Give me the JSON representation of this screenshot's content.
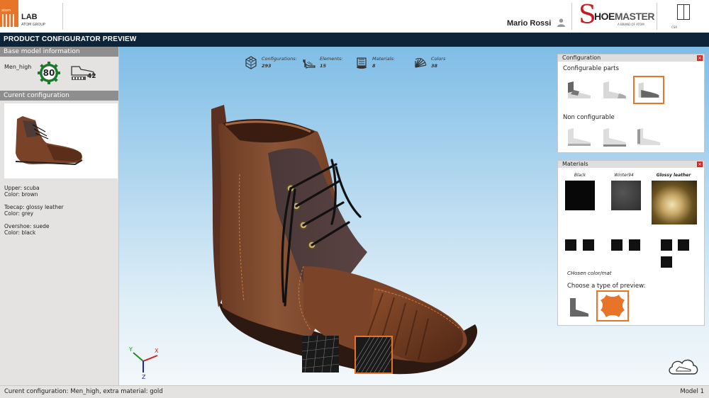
{
  "header": {
    "logo_small": "atom",
    "lab_title": "LAB",
    "lab_subtitle": "ATOM GROUP",
    "user_name": "Mario Rossi",
    "brand_name_1": "HOE",
    "brand_name_2": "MASTER",
    "brand_initial": "S",
    "brand_tag": "A BRAND OF ATOM",
    "cert_text": "CSR"
  },
  "title_bar": {
    "title": "PRODUCT CONFIGURATOR PREVIEW"
  },
  "left_panel": {
    "base_header": "Base model information",
    "model_name": "Men_high",
    "score": "80",
    "size": "42",
    "current_header": "Curent configuration",
    "components": [
      {
        "part": "Upper: scuba",
        "color": "Color: brown"
      },
      {
        "part": "Toecap: glossy leather",
        "color": "Color: grey"
      },
      {
        "part": "Overshoe: suede",
        "color": "Color: black"
      }
    ]
  },
  "stats": [
    {
      "icon": "cube-grid-icon",
      "label": "Configurations:",
      "value": "293"
    },
    {
      "icon": "high-heel-icon",
      "label": "Elements:",
      "value": "15"
    },
    {
      "icon": "material-roll-icon",
      "label": "Materials:",
      "value": "8"
    },
    {
      "icon": "color-fan-icon",
      "label": "Colors",
      "value": "38"
    }
  ],
  "configuration_panel": {
    "title": "Configuration",
    "configurable_label": "Configurable parts",
    "non_configurable_label": "Non configurable",
    "selected_part_index": 2
  },
  "materials_panel": {
    "title": "Materials",
    "materials": [
      "Black",
      "Winter94",
      "Glossy leather"
    ],
    "selected_material": "Glossy leather",
    "chosen_label": "CHosen color/mat",
    "preview_label": "Choose a type of preview:",
    "preview_options": [
      "shoe-preview-icon",
      "leather-hide-icon"
    ],
    "selected_preview_index": 1
  },
  "status_bar": {
    "text": "Curent configuration: Men_high, extra material: gold",
    "model": "Model 1"
  },
  "colors": {
    "accent": "#e8742a",
    "title_bar": "#0e2438",
    "section_header": "#8e8e8e",
    "brand_red": "#c21c24"
  }
}
